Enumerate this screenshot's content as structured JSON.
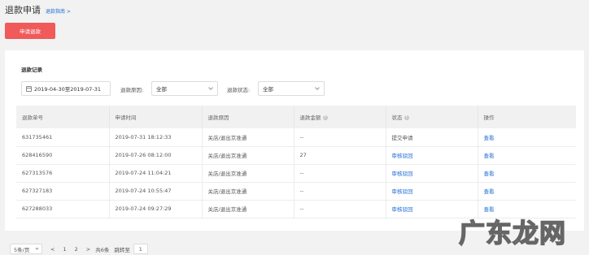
{
  "header": {
    "title": "退款申请",
    "guide_link": "退款指南 >"
  },
  "apply_button": "申请退款",
  "section_title": "退款记录",
  "filters": {
    "date_range": "2019-04-30至2019-07-31",
    "reason_label": "退款原因:",
    "reason_value": "全部",
    "status_label": "退款状态:",
    "status_value": "全部"
  },
  "table": {
    "columns": [
      "退款单号",
      "申请时间",
      "退款原因",
      "退款金额",
      "状态",
      "操作"
    ],
    "rows": [
      {
        "id": "631735461",
        "time": "2019-07-31 18:12:33",
        "reason": "关店/退出京准通",
        "amount": "--",
        "status": "提交申请",
        "action": "查看"
      },
      {
        "id": "628416590",
        "time": "2019-07-26 08:12:00",
        "reason": "关店/退出京准通",
        "amount": "27",
        "status": "审核驳回",
        "action": "查看"
      },
      {
        "id": "627313576",
        "time": "2019-07-24 11:04:21",
        "reason": "关店/退出京准通",
        "amount": "--",
        "status": "审核驳回",
        "action": "查看"
      },
      {
        "id": "627327183",
        "time": "2019-07-24 10:55:47",
        "reason": "关店/退出京准通",
        "amount": "--",
        "status": "审核驳回",
        "action": "查看"
      },
      {
        "id": "627288033",
        "time": "2019-07-24 09:27:29",
        "reason": "关店/退出京准通",
        "amount": "--",
        "status": "审核驳回",
        "action": "查看"
      }
    ]
  },
  "pagination": {
    "page_size": "5条/页",
    "prev": "<",
    "pages": [
      "1",
      "2"
    ],
    "next": ">",
    "total": "共6条",
    "jump_label": "跳转至",
    "jump_value": "1"
  },
  "watermark": "广东龙网",
  "colors": {
    "accent": "#f05a5a",
    "link": "#1e6bd6"
  }
}
